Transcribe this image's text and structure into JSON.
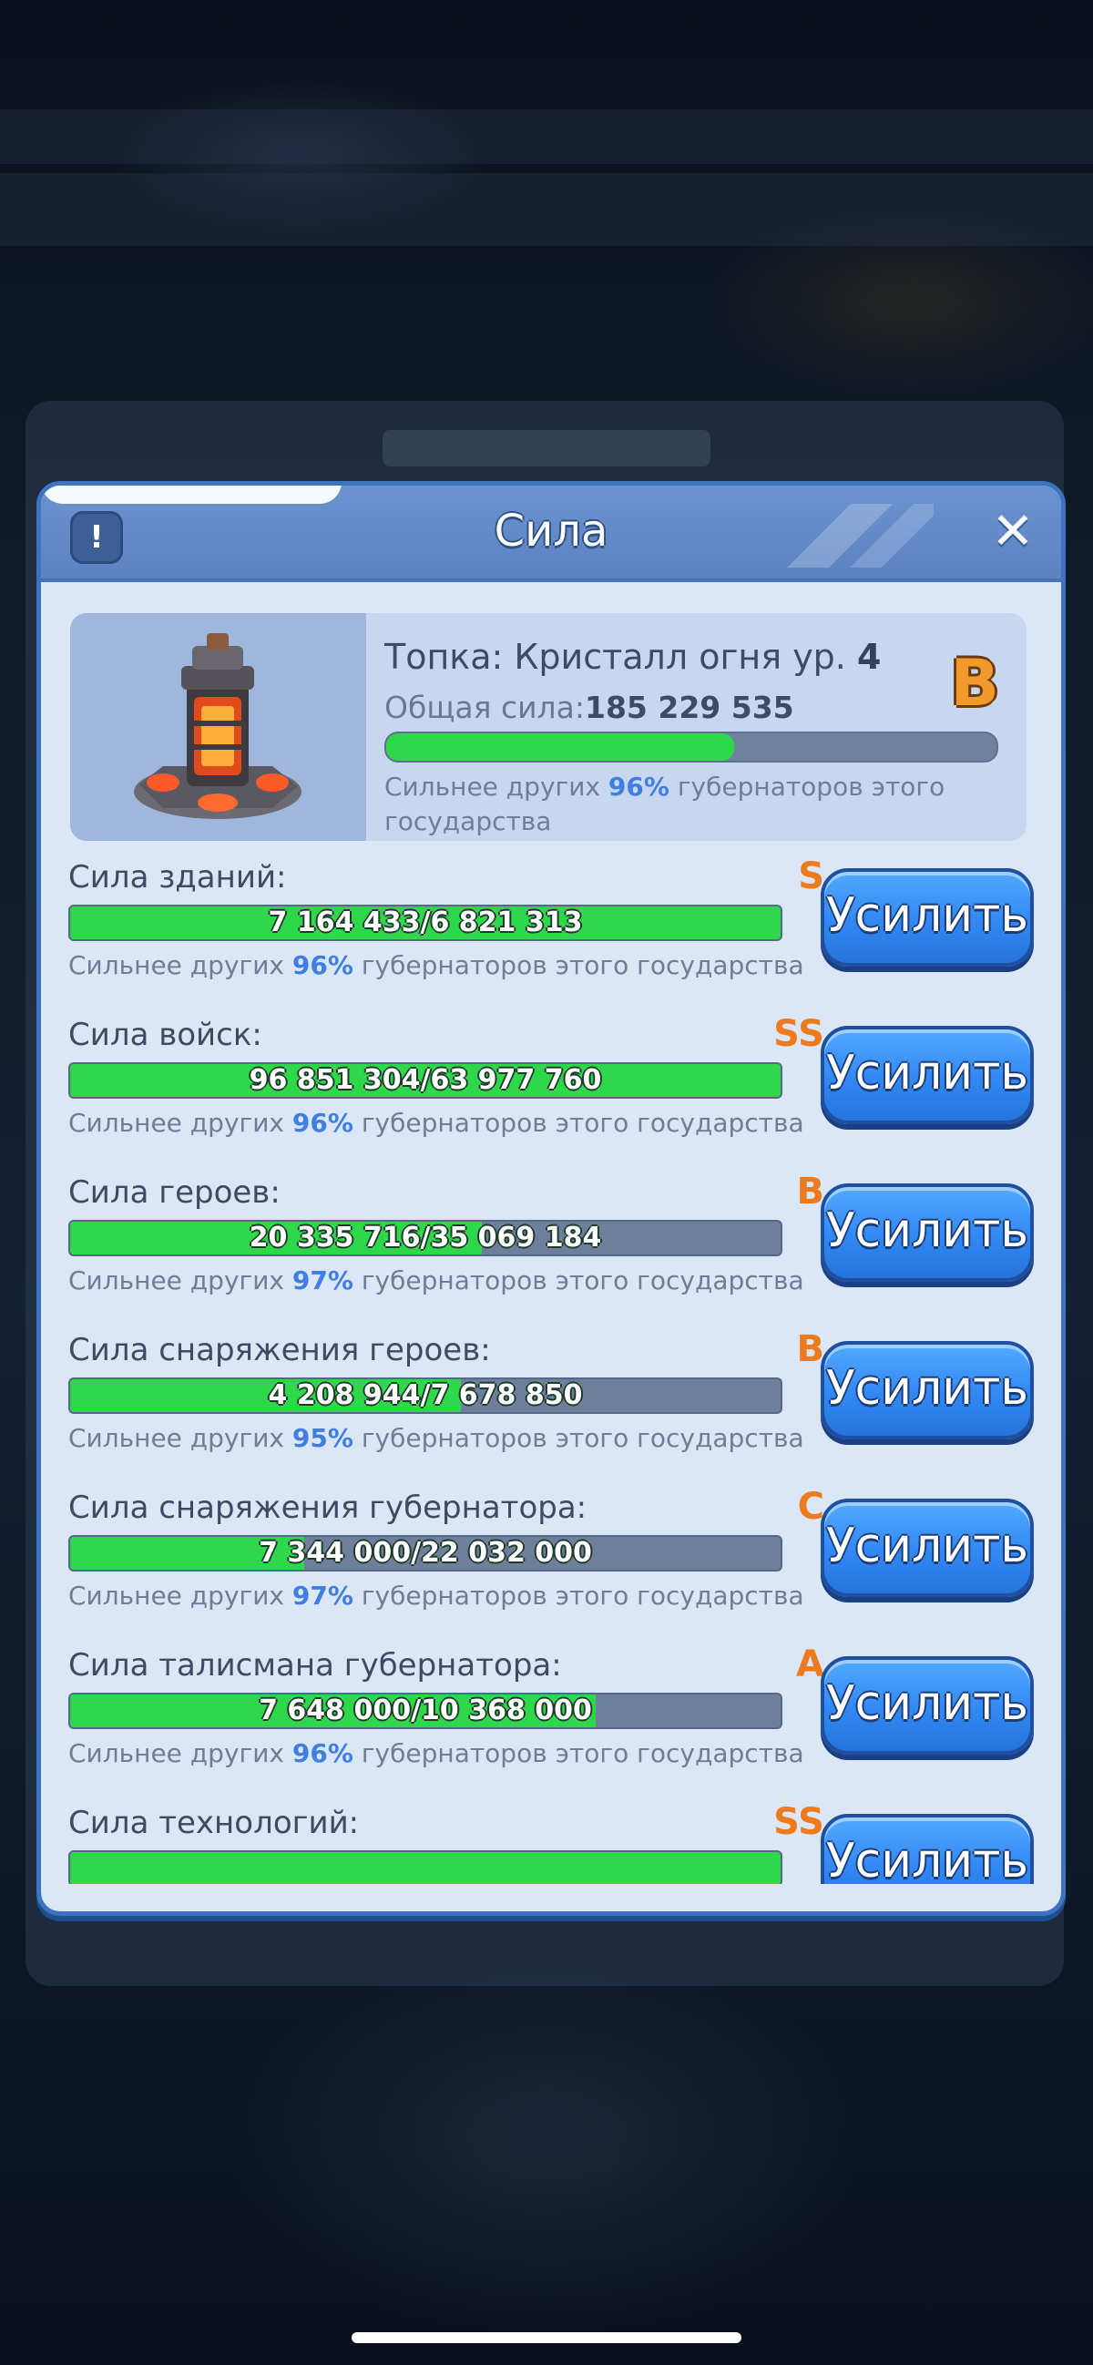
{
  "dialog": {
    "title": "Сила",
    "info_icon": "exclamation-icon",
    "close_icon": "close-x-icon"
  },
  "summary": {
    "building_name": "Топка: Кристалл огня ур.",
    "building_level": "4",
    "grade": "B",
    "total_power_label": "Общая сила:",
    "total_power_value": "185 229 535",
    "progress": 0.57,
    "note_prefix": "Сильнее других",
    "note_percent": "96%",
    "note_suffix": "губернаторов этого государства"
  },
  "rows": [
    {
      "label": "Сила зданий:",
      "grade": "S",
      "value": "7 164 433/6 821 313",
      "progress": 1.0,
      "note_prefix": "Сильнее других",
      "note_percent": "96%",
      "note_suffix": "губернаторов этого государства",
      "button": "Усилить"
    },
    {
      "label": "Сила войск:",
      "grade": "SS",
      "value": "96 851 304/63 977 760",
      "progress": 1.0,
      "note_prefix": "Сильнее других",
      "note_percent": "96%",
      "note_suffix": "губернаторов этого государства",
      "button": "Усилить"
    },
    {
      "label": "Сила героев:",
      "grade": "B",
      "value": "20 335 716/35 069 184",
      "progress": 0.58,
      "note_prefix": "Сильнее других",
      "note_percent": "97%",
      "note_suffix": "губернаторов этого государства",
      "button": "Усилить"
    },
    {
      "label": "Сила снаряжения героев:",
      "grade": "B",
      "value": "4 208 944/7 678 850",
      "progress": 0.55,
      "note_prefix": "Сильнее других",
      "note_percent": "95%",
      "note_suffix": "губернаторов этого государства",
      "button": "Усилить"
    },
    {
      "label": "Сила снаряжения губернатора:",
      "grade": "C",
      "value": "7 344 000/22 032 000",
      "progress": 0.33,
      "note_prefix": "Сильнее других",
      "note_percent": "97%",
      "note_suffix": "губернаторов этого государства",
      "button": "Усилить"
    },
    {
      "label": "Сила талисмана губернатора:",
      "grade": "A",
      "value": "7 648 000/10 368 000",
      "progress": 0.74,
      "note_prefix": "Сильнее других",
      "note_percent": "96%",
      "note_suffix": "губернаторов этого государства",
      "button": "Усилить"
    },
    {
      "label": "Сила технологий:",
      "grade": "SS",
      "value": "",
      "progress": 1.0,
      "note_prefix": "",
      "note_percent": "",
      "note_suffix": "",
      "button": "Усилить"
    }
  ]
}
